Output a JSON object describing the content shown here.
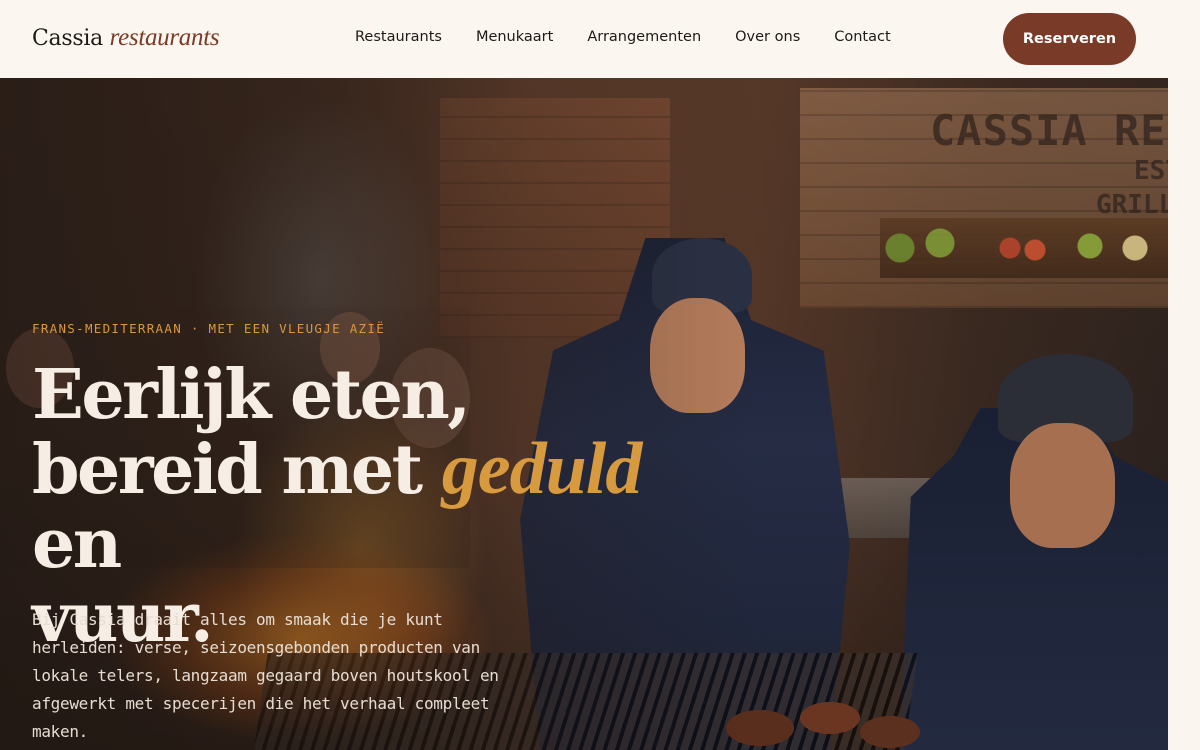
{
  "header": {
    "logo_main": "Cassia",
    "logo_accent": "restaurants",
    "nav": [
      "Restaurants",
      "Menukaart",
      "Arrangementen",
      "Over ons",
      "Contact"
    ],
    "cta_label": "Reserveren"
  },
  "hero": {
    "image_alt_icon": "grill-kitchen-photo",
    "sign": [
      "CASSIA RE",
      "EST",
      "GRILL"
    ],
    "eyebrow": "FRANS-MEDITERRAAN · MET EEN VLEUGJE AZIË",
    "headline_part1": "Eerlijk eten,",
    "headline_part2": "bereid met",
    "headline_accent": "geduld",
    "headline_part3": "en",
    "headline_part4": "vuur.",
    "intro": "Bij Cassia draait alles om smaak die je kunt herleiden: verse, seizoensgebonden producten van lokale telers, langzaam gegaard boven houtskool en afgewerkt met specerijen die het verhaal compleet maken."
  },
  "colors": {
    "brand": "#7a3a28",
    "accent_gold": "#d89a3e",
    "background": "#fbf6f0"
  }
}
